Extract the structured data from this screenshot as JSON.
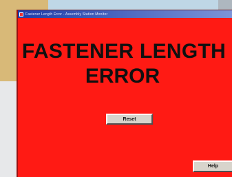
{
  "window": {
    "title": "Fastener Length Error - Assembly Station Monitor"
  },
  "message": {
    "line1": "FASTENER LENGTH",
    "line2": "ERROR"
  },
  "buttons": {
    "reset": "Reset",
    "help": "Help"
  },
  "colors": {
    "alert_background": "#ff1a14",
    "titlebar": "#1e3ca8",
    "button_face": "#d8d4cc"
  }
}
